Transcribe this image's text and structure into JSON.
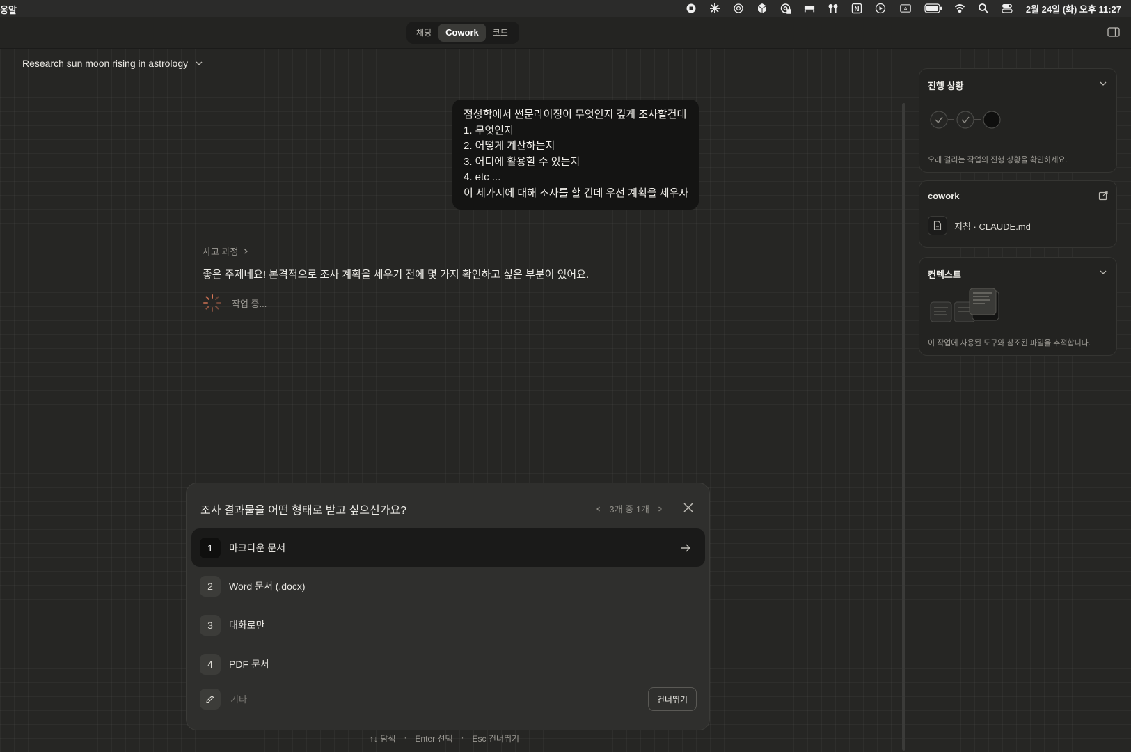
{
  "menubar": {
    "app_name": "옹알",
    "clock": "2월 24일 (화) 오후 11:27",
    "icons": [
      "record-icon",
      "asterisk-icon",
      "openai-icon",
      "box-icon",
      "at-lock-icon",
      "bed-icon",
      "airpods-icon",
      "notion-icon",
      "play-icon",
      "input-a-icon",
      "battery-icon",
      "wifi-icon",
      "spotlight-icon",
      "control-center-icon"
    ],
    "input_letter": "A",
    "notion_letter": "N"
  },
  "modes": {
    "chat": "채팅",
    "cowork": "Cowork",
    "code": "코드",
    "active": "Cowork"
  },
  "conversation": {
    "title": "Research sun moon rising in astrology",
    "user_message": [
      "점성학에서 썬문라이징이 무엇인지 깊게 조사할건데",
      "1. 무엇인지",
      "2. 어떻게 계산하는지",
      "3. 어디에 활용할 수 있는지",
      "4. etc ...",
      "이 세가지에 대해 조사를 할 건데 우선 계획을 세우자"
    ],
    "thinking_label": "사고 과정",
    "assistant_text": "좋은 주제네요! 본격적으로 조사 계획을 세우기 전에 몇 가지 확인하고 싶은 부분이 있어요.",
    "working_label": "작업 중..."
  },
  "question": {
    "text": "조사 결과물을 어떤 형태로 받고 싶으신가요?",
    "pager": "3개 중 1개",
    "options": [
      {
        "num": "1",
        "label": "마크다운 문서"
      },
      {
        "num": "2",
        "label": "Word 문서 (.docx)"
      },
      {
        "num": "3",
        "label": "대화로만"
      },
      {
        "num": "4",
        "label": "PDF 문서"
      }
    ],
    "other_placeholder": "기타",
    "skip_label": "건너뛰기"
  },
  "hints": {
    "navigate": "↑↓ 탐색",
    "select": "Enter 선택",
    "skip": "Esc 건너뛰기",
    "separator": "·"
  },
  "sidebar": {
    "progress": {
      "title": "진행 상황",
      "desc": "오래 걸리는 작업의 진행 상황을 확인하세요."
    },
    "cowork": {
      "title": "cowork",
      "file": "지침 · CLAUDE.md"
    },
    "context": {
      "title": "컨텍스트",
      "desc": "이 작업에 사용된 도구와 참조된 파일을 추적합니다."
    }
  },
  "colors": {
    "background": "#262624",
    "bubble": "#141413",
    "dialog": "#2f2f2d",
    "spinner": "#d97757"
  }
}
